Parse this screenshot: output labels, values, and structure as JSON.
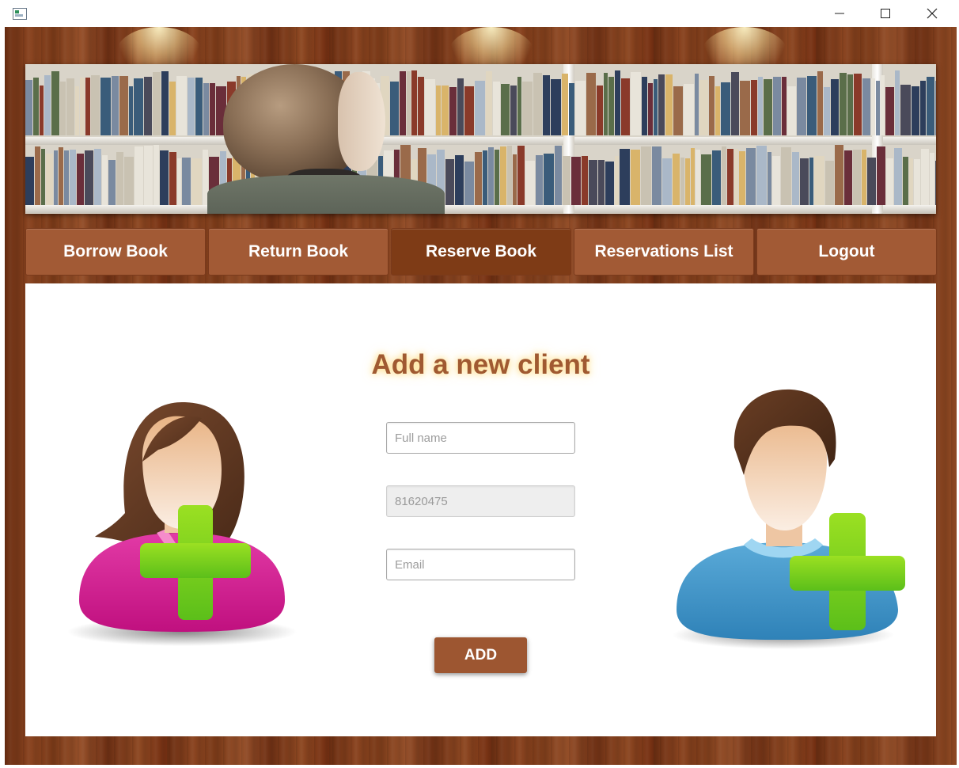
{
  "window": {
    "controls": {
      "minimize_icon": "minimize-icon",
      "maximize_icon": "maximize-icon",
      "close_icon": "close-icon"
    }
  },
  "nav": {
    "items": [
      {
        "label": "Borrow Book",
        "active": false
      },
      {
        "label": "Return Book",
        "active": false
      },
      {
        "label": "Reserve Book",
        "active": true
      },
      {
        "label": "Reservations List",
        "active": false
      },
      {
        "label": "Logout",
        "active": false
      }
    ]
  },
  "form": {
    "title": "Add a new client",
    "full_name": {
      "value": "",
      "placeholder": "Full name"
    },
    "id_field": {
      "value": "81620475",
      "disabled": true
    },
    "email": {
      "value": "",
      "placeholder": "Email"
    },
    "add_label": "ADD"
  },
  "colors": {
    "nav_button": "#a25a35",
    "nav_button_active": "#7e3b16",
    "heading": "#a05a31",
    "add_button": "#9d5631"
  }
}
